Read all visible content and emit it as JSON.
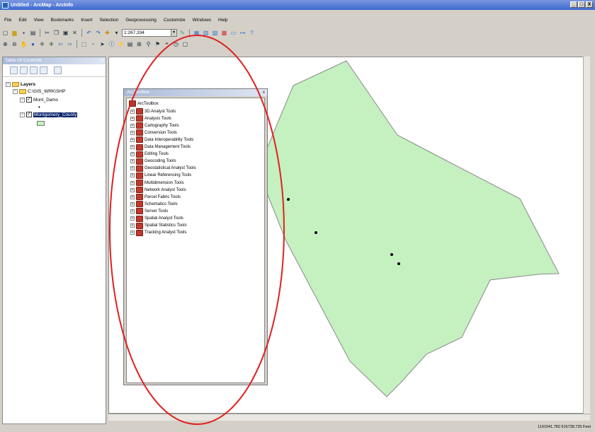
{
  "window": {
    "title": "Untitled - ArcMap - ArcInfo",
    "btn_min": "_",
    "btn_max": "□",
    "btn_close": "X"
  },
  "menu": [
    "File",
    "Edit",
    "View",
    "Bookmarks",
    "Insert",
    "Selection",
    "Geoprocessing",
    "Customize",
    "Windows",
    "Help"
  ],
  "toolbar": {
    "scale": "1:267,334"
  },
  "toc": {
    "title": "Table Of Contents",
    "close": "x",
    "layers_label": "Layers",
    "folder_label": "C:\\GIS_WRK\\SHP",
    "layer1": "Mont_Dams",
    "layer2": "Montgomery_County"
  },
  "arctoolbox": {
    "title": "ArcToolbox",
    "close": "x",
    "root": "ArcToolbox",
    "tools": [
      "3D Analyst Tools",
      "Analysis Tools",
      "Cartography Tools",
      "Conversion Tools",
      "Data Interoperability Tools",
      "Data Management Tools",
      "Editing Tools",
      "Geocoding Tools",
      "Geostatistical Analyst Tools",
      "Linear Referencing Tools",
      "Multidimension Tools",
      "Network Analyst Tools",
      "Parcel Fabric Tools",
      "Schematics Tools",
      "Server Tools",
      "Spatial Analyst Tools",
      "Spatial Statistics Tools",
      "Tracking Analyst Tools"
    ]
  },
  "status": {
    "coords": "1191041.782  615738.725 Feet"
  },
  "colors": {
    "county_fill": "#c5f0c0",
    "county_stroke": "#8a8a8a",
    "annotation_ellipse": "#e02020"
  }
}
